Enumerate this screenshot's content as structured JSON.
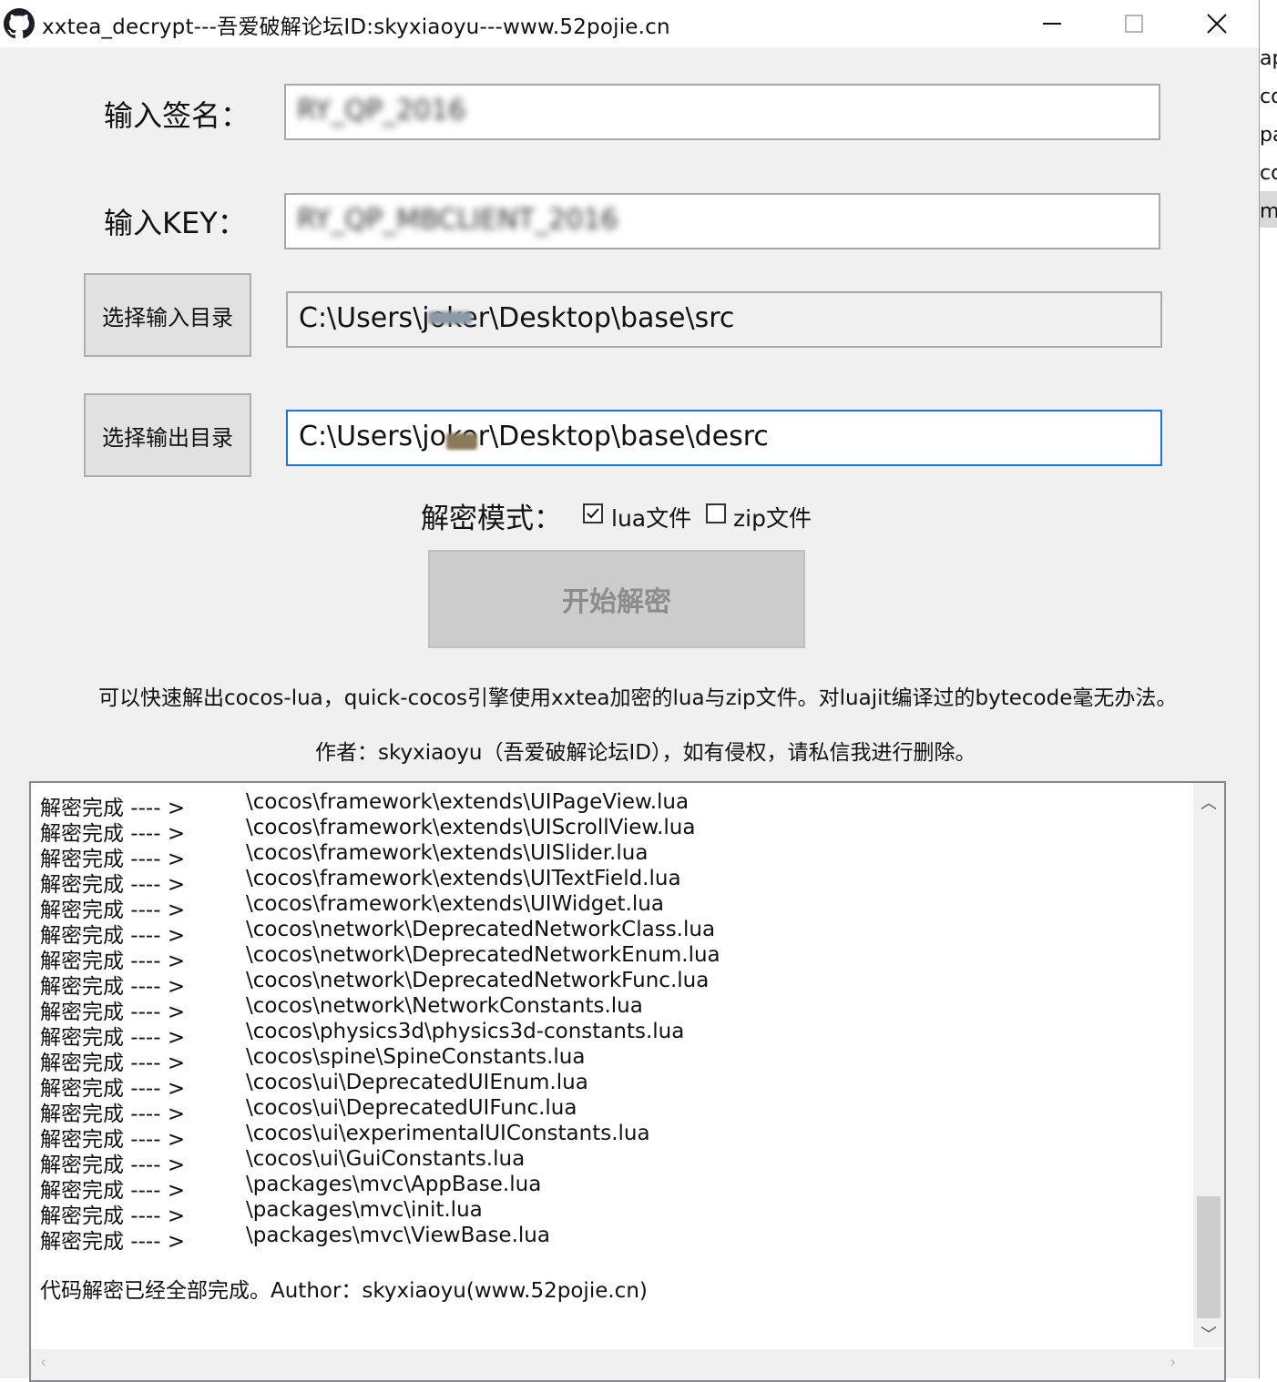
{
  "window": {
    "title": "xxtea_decrypt---吾爱破解论坛ID:skyxiaoyu---www.52pojie.cn",
    "icon": "github-icon"
  },
  "form": {
    "sign_label": "输入签名：",
    "sign_value": "RY_QP_2016",
    "key_label": "输入KEY：",
    "key_value": "RY_QP_MBCLIENT_2016",
    "input_dir_button": "选择输入目录",
    "input_dir_value": "C:\\Users\\joker\\Desktop\\base\\src",
    "output_dir_button": "选择输出目录",
    "output_dir_value": "C:\\Users\\joker\\Desktop\\base\\desrc",
    "mode_label": "解密模式：",
    "mode_options": [
      {
        "label": "lua文件",
        "checked": true
      },
      {
        "label": "zip文件",
        "checked": false
      }
    ],
    "start_button": "开始解密"
  },
  "info": {
    "description": "可以快速解出cocos-lua，quick-cocos引擎使用xxtea加密的lua与zip文件。对luajit编译过的bytecode毫无办法。",
    "author": "作者：skyxiaoyu（吾爱破解论坛ID），如有侵权，请私信我进行删除。"
  },
  "log": {
    "prefix": "解密完成 ---- >",
    "entries": [
      "\\cocos\\framework\\extends\\UIPageView.lua",
      "\\cocos\\framework\\extends\\UIScrollView.lua",
      "\\cocos\\framework\\extends\\UISlider.lua",
      "\\cocos\\framework\\extends\\UITextField.lua",
      "\\cocos\\framework\\extends\\UIWidget.lua",
      "\\cocos\\network\\DeprecatedNetworkClass.lua",
      "\\cocos\\network\\DeprecatedNetworkEnum.lua",
      "\\cocos\\network\\DeprecatedNetworkFunc.lua",
      "\\cocos\\network\\NetworkConstants.lua",
      "\\cocos\\physics3d\\physics3d-constants.lua",
      "\\cocos\\spine\\SpineConstants.lua",
      "\\cocos\\ui\\DeprecatedUIEnum.lua",
      "\\cocos\\ui\\DeprecatedUIFunc.lua",
      "\\cocos\\ui\\experimentalUIConstants.lua",
      "\\cocos\\ui\\GuiConstants.lua",
      "\\packages\\mvc\\AppBase.lua",
      "\\packages\\mvc\\init.lua",
      "\\packages\\mvc\\ViewBase.lua"
    ],
    "summary": "代码解密已经全部完成。Author：skyxiaoyu(www.52pojie.cn)"
  },
  "background_window": {
    "fragments": [
      "ap",
      "co",
      "pa",
      "co",
      "m"
    ]
  }
}
